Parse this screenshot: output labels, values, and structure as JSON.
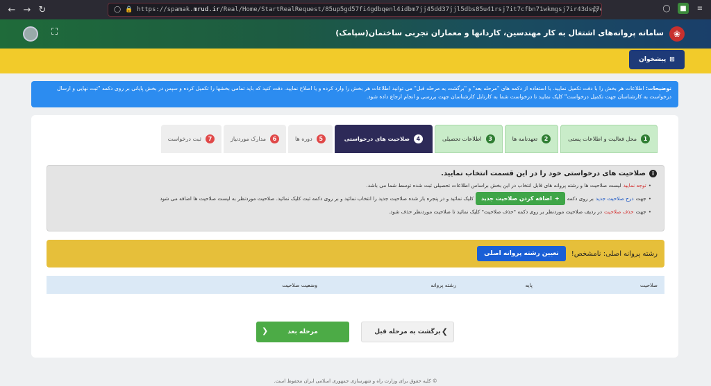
{
  "browser": {
    "url_scheme": "https://spamak.",
    "url_host": "mrud.ir",
    "url_path": "/Real/Home/StartRealRequest/85up5gd57fi4gdbqenl4idbm7jj45dd37jjl5dbs85u41rsj7it7cfbn71wkmgsj7ir43dsi7eql7e1"
  },
  "header": {
    "app_title": "سامانه پروانه‌های اشتغال به کار مهندسین، کاردانها و معماران تجربی ساختمان(سپامک)"
  },
  "toolbar": {
    "dashboard_label": "پیشخوان"
  },
  "notice": {
    "lead": "توضیحات:",
    "text": " اطلاعات هر بخش را با دقت تکمیل نمایید. با استفاده از دکمه های \"مرحله بعد\" و \"برگشت به مرحله قبل\" می توانید اطلاعات هر بخش را وارد کرده و یا اصلاح نمایید. دقت کنید که باید تمامی بخشها را تکمیل کرده و سپس در بخش پایانی بر روی دکمه \"ثبت نهایی و ارسال درخواست به کارشناسان جهت تکمیل درخواست\" کلیک نمایید تا درخواست شما به کارتابل کارشناسان جهت بررسی و انجام ارجاع داده شود."
  },
  "tabs": [
    {
      "num": "1",
      "label": "محل فعالیت و اطلاعات پستی",
      "state": "done"
    },
    {
      "num": "2",
      "label": "تعهدنامه ها",
      "state": "done"
    },
    {
      "num": "3",
      "label": "اطلاعات تحصیلی",
      "state": "done"
    },
    {
      "num": "4",
      "label": "صلاحیت های درخواستی",
      "state": "active"
    },
    {
      "num": "5",
      "label": "دوره ها",
      "state": "todo"
    },
    {
      "num": "6",
      "label": "مدارک موردنیاز",
      "state": "todo"
    },
    {
      "num": "7",
      "label": "ثبت درخواست",
      "state": "todo"
    }
  ],
  "info": {
    "title": "صلاحیت های درخواستی خود را در این قسمت انتخاب نمایید.",
    "line1_red": "توجه نمایید",
    "line1_text": " لیست صلاحیت ها و رشته پروانه های قابل انتخاب در این بخش براساس اطلاعات تحصیلی ثبت شده توسط شما می باشد.",
    "line2_a": "جهت ",
    "line2_blue": "درج صلاحیت جدید",
    "line2_b": " بر روی دکمه",
    "add_button": "اضافه کردن صلاحیت جدید",
    "line2_c": "کلیک نمائید و در پنجره باز شده صلاحیت جدید را انتخاب نمائید و بر روی دکمه ثبت کلیک نمائید. صلاحیت موردنظر به لیست صلاحیت ها اضافه می شود",
    "line3_a": "جهت ",
    "line3_red": "حذف صلاحیت",
    "line3_b": " در ردیف صلاحیت موردنظر بر روی دکمه \"حذف صلاحیت\" کلیک نمائید تا صلاحیت موردنظر حذف شود."
  },
  "major": {
    "label": "رشته پروانه اصلی: نامشخص!",
    "button": "تعیین رشته پروانه اصلی"
  },
  "table": {
    "columns": [
      "صلاحیت",
      "پایه",
      "رشته پروانه",
      "وضعیت صلاحیت"
    ]
  },
  "actions": {
    "next": "مرحله بعد",
    "prev": "برگشت به مرحله قبل"
  },
  "footer": {
    "text": "© کلیه حقوق برای وزارت راه و شهرسازی جمهوری اسلامی ایران محفوظ است."
  }
}
